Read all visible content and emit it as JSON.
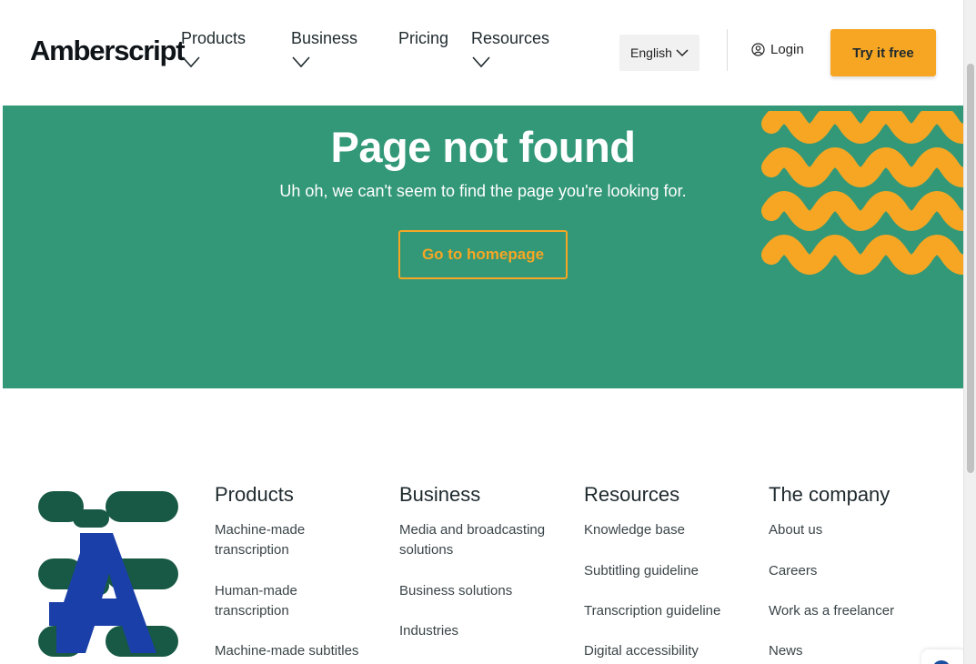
{
  "header": {
    "logo": "Amberscript",
    "nav": [
      {
        "label": "Products"
      },
      {
        "label": "Business"
      },
      {
        "label": "Pricing"
      },
      {
        "label": "Resources"
      }
    ],
    "language": "English",
    "login": "Login",
    "cta": "Try it free"
  },
  "hero": {
    "title": "Page not found",
    "subtitle": "Uh oh, we can't seem to find the page you're looking for.",
    "button": "Go to homepage"
  },
  "footer": {
    "columns": [
      {
        "title": "Products",
        "links": [
          "Machine-made transcription",
          "Human-made transcription",
          "Machine-made subtitles"
        ]
      },
      {
        "title": "Business",
        "links": [
          "Media and broadcasting solutions",
          "Business solutions",
          "Industries"
        ]
      },
      {
        "title": "Resources",
        "links": [
          "Knowledge base",
          "Subtitling guideline",
          "Transcription guideline",
          "Digital accessibility"
        ]
      },
      {
        "title": "The company",
        "links": [
          "About us",
          "Careers",
          "Work as a freelancer",
          "News"
        ]
      }
    ]
  },
  "colors": {
    "brand_green": "#339877",
    "brand_orange": "#f6a623",
    "dark_green": "#175945",
    "logo_blue": "#1b3fa8"
  }
}
